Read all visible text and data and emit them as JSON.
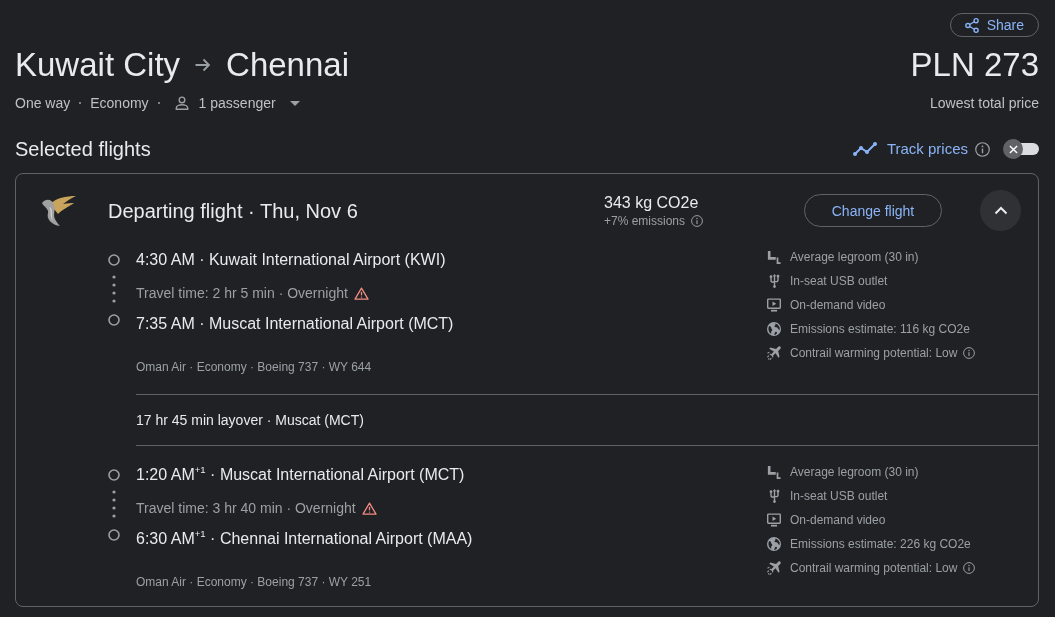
{
  "share_button": {
    "label": "Share"
  },
  "route": {
    "origin": "Kuwait City",
    "destination": "Chennai"
  },
  "price": {
    "amount": "PLN 273",
    "caption": "Lowest total price"
  },
  "trip_options": [
    {
      "kind": "text",
      "label": "One way"
    },
    {
      "kind": "text",
      "label": "Economy"
    },
    {
      "kind": "passengers",
      "label": "1 passenger"
    }
  ],
  "section_title": "Selected flights",
  "track_prices": {
    "label": "Track prices",
    "on": false
  },
  "flight_card": {
    "title": "Departing flight · Thu, Nov 6",
    "emissions": "343 kg CO2e",
    "emissions_change": "+7% emissions",
    "change_button": "Change flight",
    "expanded": true,
    "segments": [
      {
        "kind": "leg",
        "departure": "4:30 AM · Kuwait International Airport (KWI)",
        "travel_time": "Travel time: 2 hr 5 min · Overnight",
        "warning": true,
        "arrival": "7:35 AM · Muscat International Airport (MCT)",
        "details": "Oman Air · Economy · Boeing 737 · WY 644",
        "amenities": [
          {
            "kind": "legroom",
            "label": "Average legroom (30 in)",
            "info": false
          },
          {
            "kind": "usb",
            "label": "In-seat USB outlet",
            "info": false
          },
          {
            "kind": "video",
            "label": "On-demand video",
            "info": false
          },
          {
            "kind": "emissions",
            "label": "Emissions estimate: 116 kg CO2e",
            "info": false
          },
          {
            "kind": "contrail",
            "label": "Contrail warming potential: Low",
            "info": true
          }
        ]
      },
      {
        "kind": "layover",
        "text": "17 hr 45 min layover · Muscat (MCT)"
      },
      {
        "kind": "leg",
        "departure": "1:20 AM$^{+1}$ · Muscat International Airport (MCT)",
        "travel_time": "Travel time: 3 hr 40 min · Overnight",
        "warning": true,
        "arrival": "6:30 AM$^{+1}$ · Chennai International Airport (MAA)",
        "details": "Oman Air · Economy · Boeing 737 · WY 251",
        "amenities": [
          {
            "kind": "legroom",
            "label": "Average legroom (30 in)",
            "info": false
          },
          {
            "kind": "usb",
            "label": "In-seat USB outlet",
            "info": false
          },
          {
            "kind": "video",
            "label": "On-demand video",
            "info": false
          },
          {
            "kind": "emissions",
            "label": "Emissions estimate: 226 kg CO2e",
            "info": false
          },
          {
            "kind": "contrail",
            "label": "Contrail warming potential: Low",
            "info": true
          }
        ]
      }
    ]
  }
}
